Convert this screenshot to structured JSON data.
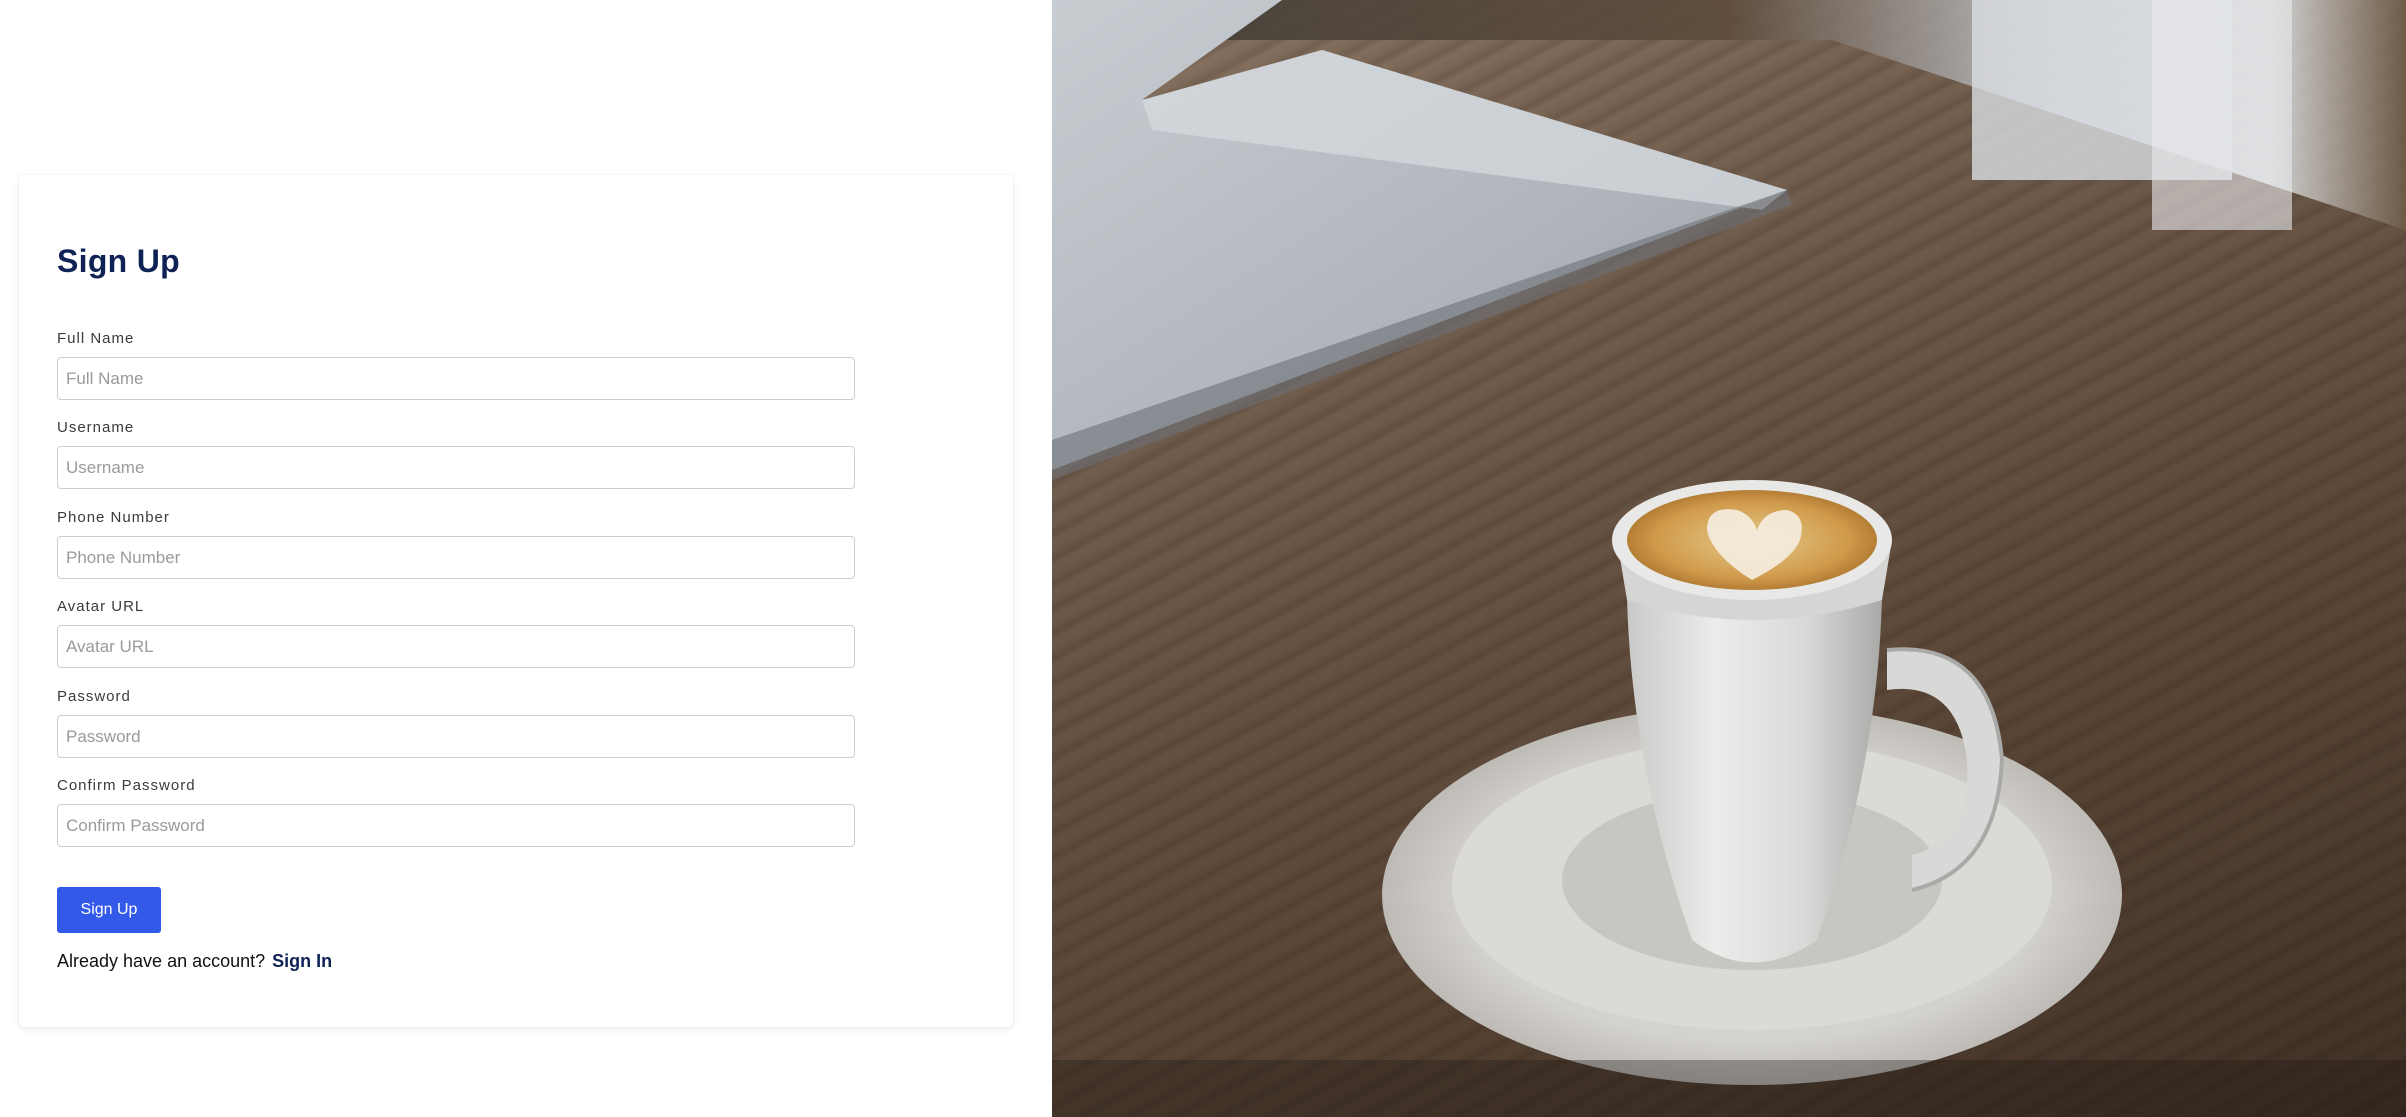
{
  "form": {
    "title": "Sign Up",
    "fields": [
      {
        "label": "Full Name",
        "placeholder": "Full Name"
      },
      {
        "label": "Username",
        "placeholder": "Username"
      },
      {
        "label": "Phone Number",
        "placeholder": "Phone Number"
      },
      {
        "label": "Avatar URL",
        "placeholder": "Avatar URL"
      },
      {
        "label": "Password",
        "placeholder": "Password"
      },
      {
        "label": "Confirm Password",
        "placeholder": "Confirm Password"
      }
    ],
    "submit_label": "Sign Up",
    "signin_prompt": "Already have an account?",
    "signin_link": "Sign In"
  },
  "colors": {
    "title": "#0f2255",
    "primary_button": "#3359e8",
    "link": "#0f2255"
  },
  "hero_image": {
    "subject": "coffee-cup-photo"
  }
}
